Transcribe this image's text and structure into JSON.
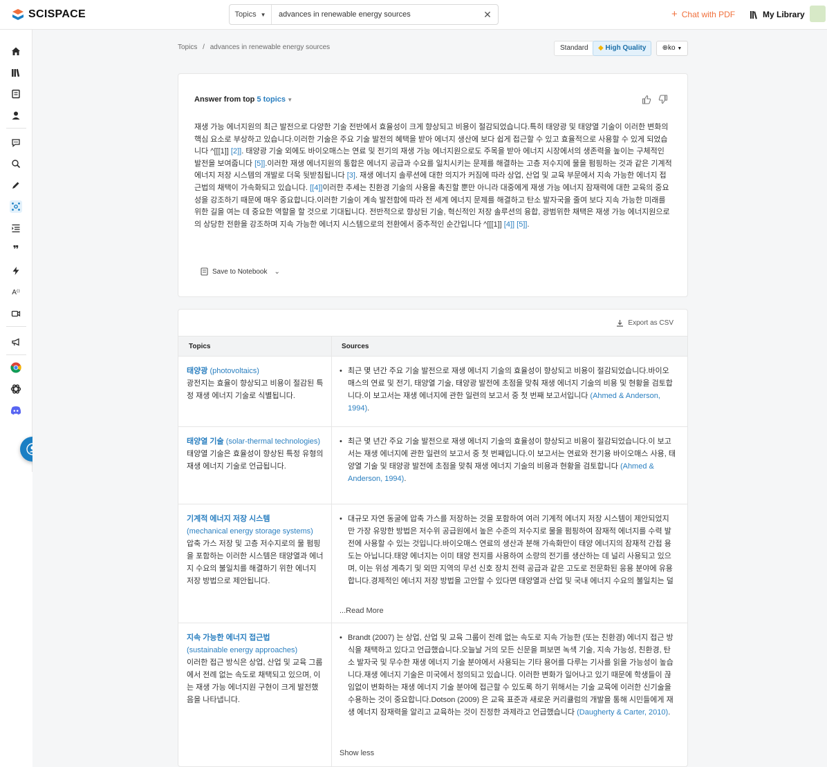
{
  "header": {
    "logo_text": "SCISPACE",
    "search": {
      "type_label": "Topics",
      "query": "advances in renewable energy sources"
    },
    "chat_pdf_label": "Chat with PDF",
    "library_label": "My Library"
  },
  "breadcrumb": {
    "root": "Topics",
    "sep": "/",
    "current": "advances in renewable energy sources"
  },
  "quality": {
    "standard_label": "Standard",
    "high_label": "High Quality",
    "lang_label": "ko"
  },
  "answer": {
    "prefix": "Answer from top ",
    "count_link": "5 topics",
    "body_1": "재생 가능 에너지원의 최근 발전으로 다양한 기술 전반에서 효율성이 크게 향상되고 비용이 절감되었습니다.특히 태양광 및 태양열 기술이 이러한 변화의 핵심 요소로 부상하고 있습니다.이러한 기술은 주요 기술 발전의 혜택을 받아 에너지 생산에 보다 쉽게 접근할 수 있고 효율적으로 사용할 수 있게 되었습니다 ^[[[1]] ",
    "cite_1": "[2]]",
    "body_2": ". 태양광 기술 외에도 바이오매스는 연료 및 전기의 재생 가능 에너지원으로도 주목을 받아 에너지 시장에서의 생존력을 높이는 구체적인 발전을 보여줍니다 ",
    "cite_2": "[5]]",
    "body_3": ".이러한 재생 에너지원의 통합은 에너지 공급과 수요를 일치시키는 문제를 해결하는 고층 저수지에 물을 펌핑하는 것과 같은 기계적 에너지 저장 시스템의 개발로 더욱 뒷받침됩니다 ",
    "cite_3": "[3]",
    "body_4": ". 재생 에너지 솔루션에 대한 의지가 커짐에 따라 상업, 산업 및 교육 부문에서 지속 가능한 에너지 접근법의 채택이 가속화되고 있습니다. ",
    "cite_4": "[[4]]",
    "body_5": "이러한 추세는 친환경 기술의 사용을 촉진할 뿐만 아니라 대중에게 재생 가능 에너지 잠재력에 대한 교육의 중요성을 강조하기 때문에 매우 중요합니다.이러한 기술이 계속 발전함에 따라 전 세계 에너지 문제를 해결하고 탄소 발자국을 줄여 보다 지속 가능한 미래를 위한 길을 여는 데 중요한 역할을 할 것으로 기대됩니다. 전반적으로 향상된 기술, 혁신적인 저장 솔루션의 융합, 광범위한 채택은 재생 가능 에너지원으로의 상당한 전환을 강조하며 지속 가능한 에너지 시스템으로의 전환에서 중추적인 순간입니다 ^[[[1]] ",
    "cite_5": "[4]] [5]]",
    "body_6": ".",
    "save_label": "Save to Notebook"
  },
  "table": {
    "export_label": "Export as CSV",
    "col_topics": "Topics",
    "col_sources": "Sources",
    "rows": [
      {
        "title": "태양광",
        "en": "(photovoltaics)",
        "desc": "광전지는 효율이 향상되고 비용이 절감된 특정 재생 에너지 기술로 식별됩니다.",
        "source": "최근 몇 년간 주요 기술 발전으로 재생 에너지 기술의 효율성이 향상되고 비용이 절감되었습니다.바이오매스의 연료 및 전기, 태양열 기술, 태양광 발전에 초점을 맞춰 재생 에너지 기술의 비용 및 현황을 검토합니다.이 보고서는 재생 에너지에 관한 일련의 보고서 중 첫 번째 보고서입니다 ",
        "cite": "(Ahmed & Anderson, 1994)",
        "more": ""
      },
      {
        "title": "태양열 기술",
        "en": "(solar-thermal technologies)",
        "desc": "태양열 기술은 효율성이 향상된 특정 유형의 재생 에너지 기술로 언급됩니다.",
        "source": "최근 몇 년간 주요 기술 발전으로 재생 에너지 기술의 효율성이 향상되고 비용이 절감되었습니다.이 보고서는 재생 에너지에 관한 일련의 보고서 중 첫 번째입니다.이 보고서는 연료와 전기용 바이오매스 사용, 태양열 기술 및 태양광 발전에 초점을 맞춰 재생 에너지 기술의 비용과 현황을 검토합니다 ",
        "cite": "(Ahmed & Anderson, 1994)",
        "more": ""
      },
      {
        "title": "기계적 에너지 저장 시스템",
        "en": "(mechanical energy storage systems)",
        "desc": "압축 가스 저장 및 고층 저수지로의 물 펌핑을 포함하는 이러한 시스템은 태양열과 에너지 수요의 불일치를 해결하기 위한 에너지 저장 방법으로 제안됩니다.",
        "source": "대규모 자연 동굴에 압축 가스를 저장하는 것을 포함하여 여러 기계적 에너지 저장 시스템이 제안되었지만 가장 유망한 방법은 저수위 공급원에서 높은 수준의 저수지로 물을 펌핑하여 잠재적 에너지를 수력 발전에 사용할 수 있는 것입니다.바이오매스 연료의 생산과 분해 가속화만이 태양 에너지의 잠재적 간접 용도는 아닙니다.태양 에너지는 이미 태양 전지를 사용하여 소량의 전기를 생산하는 데 널리 사용되고 있으며, 이는 위성 계측기 및 외딴 지역의 무선 신호 장치 전력 공급과 같은 고도로 전문화된 응용 분야에 유용합니다.경제적인 에너지 저장 방법을 고안할 수 있다면 태양열과 산업 및 국내 에너지 수요의 불일치는 덜",
        "cite": "",
        "more": "...Read More"
      },
      {
        "title": "지속 가능한 에너지 접근법",
        "en": "(sustainable energy approaches)",
        "desc": "이러한 접근 방식은 상업, 산업 및 교육 그룹에서 전례 없는 속도로 채택되고 있으며, 이는 재생 가능 에너지원 구현이 크게 발전했음을 나타냅니다.",
        "source": "Brandt (2007) 는 상업, 산업 및 교육 그룹이 전례 없는 속도로 지속 가능한 (또는 친환경) 에너지 접근 방식을 채택하고 있다고 언급했습니다.오늘날 거의 모든 신문을 펴보면 녹색 기술, 지속 가능성, 친환경, 탄소 발자국 및 무수한 재생 에너지 기술 분야에서 사용되는 기타 용어를 다루는 기사를 읽을 가능성이 높습니다.재생 에너지 기술은 미국에서 정의되고 있습니다. 이러한 변화가 일어나고 있기 때문에 학생들이 끊임없이 변화하는 재생 에너지 기술 분야에 접근할 수 있도록 하기 위해서는 기술 교육에 이러한 신기술을 수용하는 것이 중요합니다.Dotson (2009) 은 교육 표준과 새로운 커리큘럼의 개발을 통해 시민들에게 재생 에너지 잠재력을 알리고 교육하는 것이 진정한 과제라고 언급했습니다 ",
        "cite": "(Daugherty & Carter, 2010)",
        "more": "Show less"
      }
    ]
  }
}
